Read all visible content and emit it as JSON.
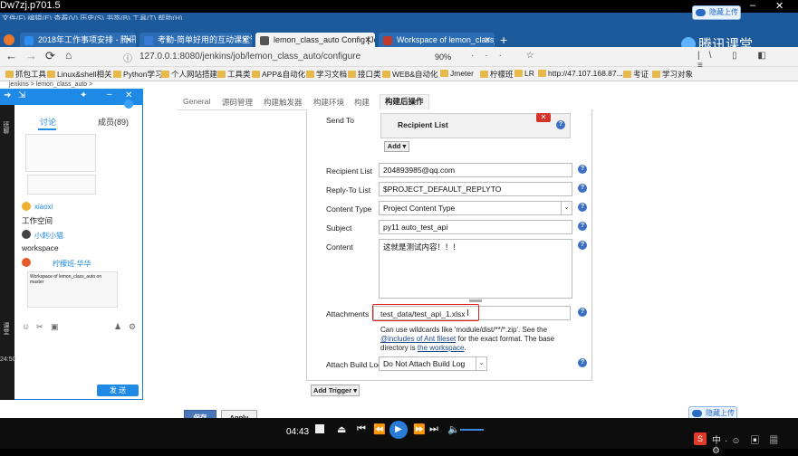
{
  "video": {
    "title": "Dw7zj.p701.5",
    "time": "04:43"
  },
  "browser": {
    "menu": "文件(F)  编辑(E)  查看(V)  历史(S)  书签(B)  工具(T)  帮助(H)",
    "tabs": [
      {
        "label": "2018年工作事项安排 - 腾讯文",
        "color": "#2d8cf0"
      },
      {
        "label": "考勤-简单好用的互动课堂管理",
        "color": "#3a7bd5"
      },
      {
        "label": "lemon_class_auto Config [Je",
        "color": "#555555"
      },
      {
        "label": "Workspace of lemon_class_a",
        "color": "#c0392b"
      }
    ],
    "new_tab": "+",
    "url": "127.0.0.1:8080/jenkins/job/lemon_class_auto/configure",
    "zoom": "90%",
    "bookmarks": [
      "抓包工具",
      "Linux&shell相关",
      "Python学习",
      "个人网站搭建",
      "工具类",
      "APP&自动化",
      "学习文档",
      "接口类",
      "WEB&自动化",
      "Jmeter",
      "柠檬班",
      "LR",
      "http://47.107.168.87...",
      "考证",
      "学习对象"
    ]
  },
  "tencent": {
    "brand": "腾讯课堂",
    "top_button": "隐藏上传",
    "bottom_button": "隐藏上传"
  },
  "chat": {
    "tabs": [
      "讨论",
      "成员(89)"
    ],
    "breadcrumb": "jenkins > lemon_class_auto >",
    "msgs": [
      {
        "user": "xiaoxi",
        "text": "工作空间"
      },
      {
        "user": "小刺小猫",
        "text": "workspace"
      },
      {
        "user": "柠檬班-华华",
        "text": "Workspace of lemon_class_auto on master"
      }
    ],
    "send": "发 送",
    "side_labels": [
      "班聊",
      "课堂"
    ],
    "side_time": "24:50"
  },
  "jenkins": {
    "tabs": [
      "General",
      "源码管理",
      "构建触发器",
      "构建环境",
      "构建",
      "构建后操作"
    ],
    "send_to": "Send To",
    "recipient_list_box": "Recipient List",
    "add": "Add ▾",
    "fields": [
      {
        "label": "Recipient List",
        "value": "204893985@qq.com"
      },
      {
        "label": "Reply-To List",
        "value": "$PROJECT_DEFAULT_REPLYTO"
      },
      {
        "label": "Content Type",
        "value": "Project Content Type"
      },
      {
        "label": "Subject",
        "value": "py11 auto_test_api"
      },
      {
        "label": "Content",
        "value": "这就是测试内容！！！"
      },
      {
        "label": "Attachments",
        "value": "test_data/test_api_1.xlsx"
      },
      {
        "label": "Attach Build Log",
        "value": "Do Not Attach Build Log"
      }
    ],
    "help_text": {
      "p1": "Can use wildcards like 'module/dist/**/*.zip'. See the ",
      "link1": "@includes of Ant fileset",
      "p2": " for the exact format. The base directory is ",
      "link2": "the workspace",
      "p3": "."
    },
    "add_trigger": "Add Trigger ▾",
    "save": "保存",
    "apply": "Apply"
  },
  "colors": {
    "accent": "#1f89e6",
    "jenkins_blue": "#4b75b9",
    "highlight": "#e02020"
  }
}
